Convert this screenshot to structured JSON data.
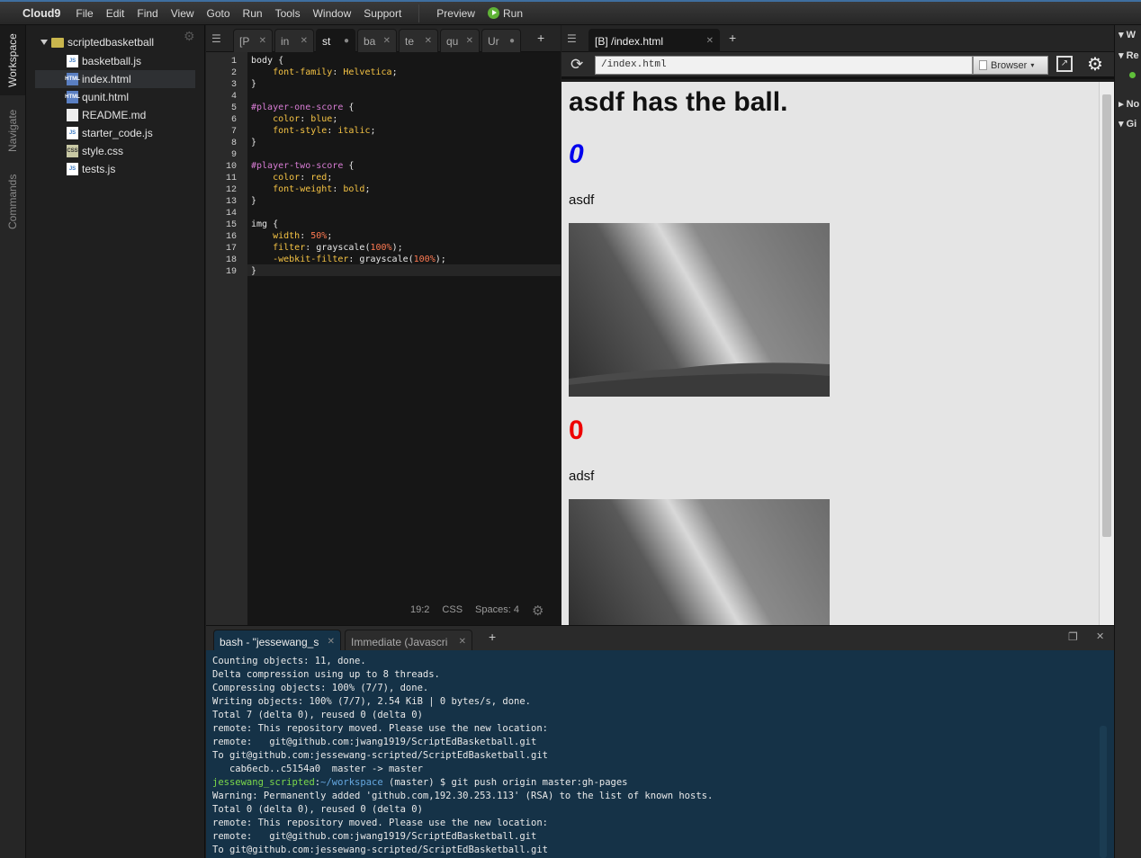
{
  "menubar": {
    "logo": "Cloud9",
    "items": [
      "File",
      "Edit",
      "Find",
      "View",
      "Goto",
      "Run",
      "Tools",
      "Window",
      "Support"
    ],
    "preview": "Preview",
    "run": "Run"
  },
  "left_rail": {
    "workspace": "Workspace",
    "navigate": "Navigate",
    "commands": "Commands"
  },
  "tree": {
    "root": "scriptedbasketball",
    "files": [
      {
        "name": "basketball.js",
        "type": "js"
      },
      {
        "name": "index.html",
        "type": "html"
      },
      {
        "name": "qunit.html",
        "type": "html"
      },
      {
        "name": "README.md",
        "type": "md"
      },
      {
        "name": "starter_code.js",
        "type": "js"
      },
      {
        "name": "style.css",
        "type": "css"
      },
      {
        "name": "tests.js",
        "type": "js"
      }
    ]
  },
  "editor_tabs": [
    "[P",
    "in",
    "st",
    "ba",
    "te",
    "qu",
    "Ur"
  ],
  "code_lines": [
    "body {",
    "    font-family: Helvetica;",
    "}",
    "",
    "#player-one-score {",
    "    color: blue;",
    "    font-style: italic;",
    "}",
    "",
    "#player-two-score {",
    "    color: red;",
    "    font-weight: bold;",
    "}",
    "",
    "img {",
    "    width: 50%;",
    "    filter: grayscale(100%);",
    "    -webkit-filter: grayscale(100%);",
    "}"
  ],
  "status": {
    "position": "19:2",
    "mode": "CSS",
    "spaces": "Spaces: 4"
  },
  "preview": {
    "tab": "[B] /index.html",
    "url": "/index.html",
    "browser": "Browser",
    "heading": "asdf has the ball.",
    "score1": "0",
    "name1": "asdf",
    "score2": "0",
    "name2": "adsf"
  },
  "right_panel": [
    "W",
    "Re",
    "No",
    "Gi"
  ],
  "terminal": {
    "tab1": "bash - \"jessewang_s",
    "tab2": "Immediate (Javascri",
    "lines": [
      "Counting objects: 11, done.",
      "Delta compression using up to 8 threads.",
      "Compressing objects: 100% (7/7), done.",
      "Writing objects: 100% (7/7), 2.54 KiB | 0 bytes/s, done.",
      "Total 7 (delta 0), reused 0 (delta 0)",
      "remote: This repository moved. Please use the new location:",
      "remote:   git@github.com:jwang1919/ScriptEdBasketball.git",
      "To git@github.com:jessewang-scripted/ScriptEdBasketball.git",
      "   cab6ecb..c5154a0  master -> master"
    ],
    "prompt_user": "jessewang_scripted",
    "prompt_path": "~/workspace",
    "prompt_cmd": " (master) $ git push origin master:gh-pages",
    "lines2": [
      "Warning: Permanently added 'github.com,192.30.253.113' (RSA) to the list of known hosts.",
      "Total 0 (delta 0), reused 0 (delta 0)",
      "remote: This repository moved. Please use the new location:",
      "remote:   git@github.com:jwang1919/ScriptEdBasketball.git",
      "To git@github.com:jessewang-scripted/ScriptEdBasketball.git"
    ]
  }
}
